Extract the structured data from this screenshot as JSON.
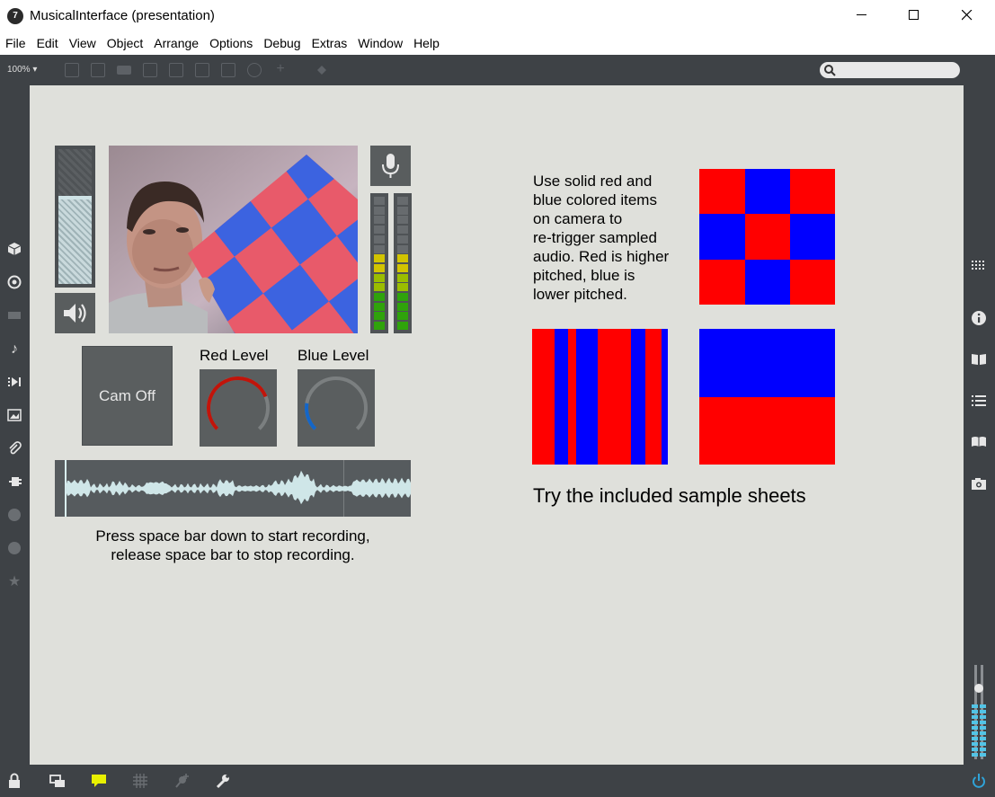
{
  "window": {
    "title": "MusicalInterface (presentation)",
    "logo": "7"
  },
  "menu": [
    "File",
    "Edit",
    "View",
    "Object",
    "Arrange",
    "Options",
    "Debug",
    "Extras",
    "Window",
    "Help"
  ],
  "toolbar": {
    "zoom": "100%"
  },
  "canvas": {
    "cam_button": "Cam Off",
    "red_level_label": "Red Level",
    "blue_level_label": "Blue Level",
    "red_level_value": 0.75,
    "blue_level_value": 0.2,
    "instructions_line1": "Press space bar down to start recording,",
    "instructions_line2": "release space bar to stop recording.",
    "description_lines": [
      "Use solid red and",
      "blue colored items",
      "on camera to",
      "re-trigger sampled",
      "audio. Red is higher",
      "pitched, blue is",
      "lower pitched."
    ],
    "sheets_caption": "Try the included sample sheets"
  },
  "colors": {
    "red": "#ff0000",
    "blue": "#0000ff",
    "canvas_bg": "#dfe0db",
    "chrome": "#3e4246",
    "dial_red": "#c1140a",
    "dial_blue": "#1466c8"
  },
  "icons": {
    "left_sidebar": [
      "cube-icon",
      "target-icon",
      "film-icon",
      "music-note-icon",
      "play-list-icon",
      "image-icon",
      "paperclip-icon",
      "plug-icon",
      "v-circle-icon",
      "b-circle-icon",
      "star-icon"
    ],
    "right_sidebar": [
      "grid-icon",
      "info-icon",
      "book-open-icon",
      "list-icon",
      "book-icon",
      "camera-icon"
    ],
    "bottom": [
      "lock-icon",
      "windows-icon",
      "comment-icon",
      "grid-icon",
      "pin-add-icon",
      "wrench-icon",
      "power-icon"
    ]
  }
}
